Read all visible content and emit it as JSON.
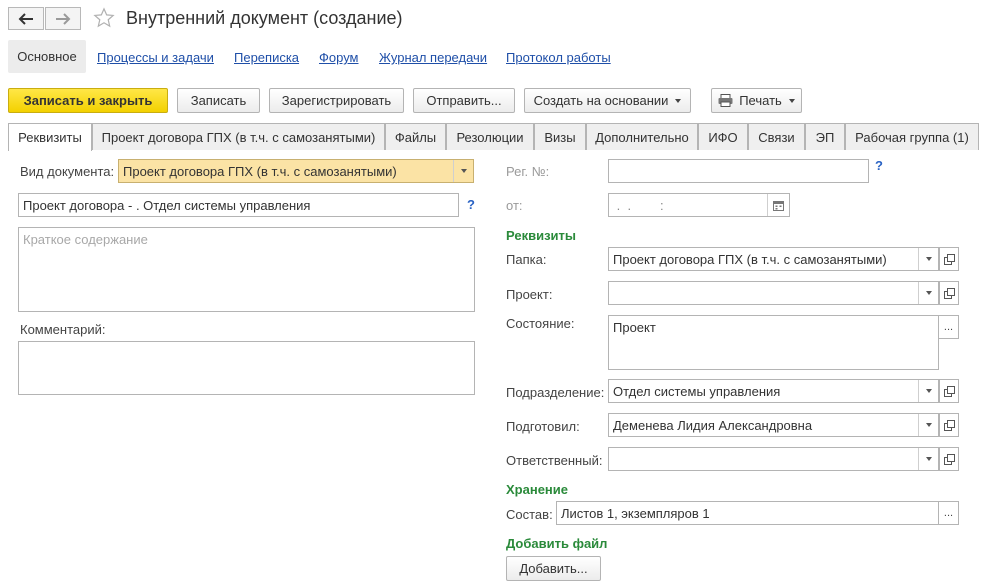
{
  "window": {
    "title": "Внутренний документ (создание)"
  },
  "icons": {
    "back": "arrow-left-icon",
    "forward": "arrow-right-icon",
    "favorite": "star-icon",
    "print": "printer-icon",
    "calendar": "calendar-icon",
    "open": "open-window-icon"
  },
  "sections": {
    "active": "Основное",
    "links": [
      "Процессы и задачи",
      "Переписка",
      "Форум",
      "Журнал передачи",
      "Протокол работы"
    ]
  },
  "toolbar": {
    "save_close": "Записать и закрыть",
    "save": "Записать",
    "register": "Зарегистрировать",
    "send": "Отправить...",
    "create_based": "Создать на основании",
    "print": "Печать"
  },
  "tabs": [
    "Реквизиты",
    "Проект договора ГПХ (в т.ч. с самозанятыми)",
    "Файлы",
    "Резолюции",
    "Визы",
    "Дополнительно",
    "ИФО",
    "Связи",
    "ЭП",
    "Рабочая группа (1)"
  ],
  "left": {
    "doc_type_label": "Вид документа:",
    "doc_type_value": "Проект договора ГПХ (в т.ч. с самозанятыми)",
    "name_value": "Проект договора  - . Отдел системы управления",
    "help_mark": "?",
    "summary_placeholder": "Краткое содержание",
    "comment_label": "Комментарий:"
  },
  "right": {
    "reg_no_label": "Рег. №:",
    "help_mark": "?",
    "date_label": "от:",
    "date_mask": " .  .        :   ",
    "requisites_title": "Реквизиты",
    "folder_label": "Папка:",
    "folder_value": "Проект договора ГПХ (в т.ч. с самозанятыми)",
    "project_label": "Проект:",
    "project_value": "",
    "state_label": "Состояние:",
    "state_value": "Проект",
    "division_label": "Подразделение:",
    "division_value": "Отдел системы управления",
    "prepared_label": "Подготовил:",
    "prepared_value": "Деменева Лидия Александровна",
    "responsible_label": "Ответственный:",
    "responsible_value": "",
    "storage_title": "Хранение",
    "composition_label": "Состав:",
    "composition_value": "Листов 1, экземпляров 1",
    "add_file_title": "Добавить файл",
    "add_button": "Добавить...",
    "ellipsis": "..."
  }
}
